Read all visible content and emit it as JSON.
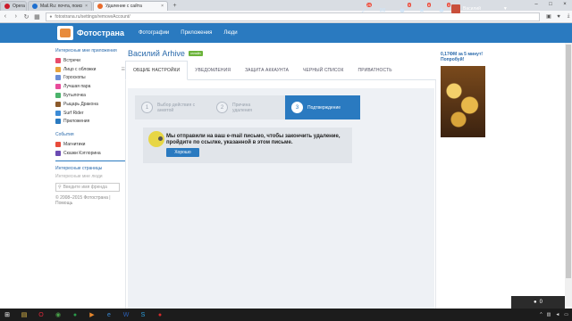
{
  "browser": {
    "tabs": [
      {
        "label": "Opera",
        "color": "#cc1b2b",
        "active": false
      },
      {
        "label": "Mail.Ru: почта, поиск в ...",
        "color": "#1e6fcf",
        "active": false
      },
      {
        "label": "Удаление с сайта",
        "color": "#e86b2c",
        "active": true
      }
    ],
    "url": "fotostrana.ru/settings/removeAccount/"
  },
  "site": {
    "logo": "Фотострана",
    "nav": [
      "Фотографии",
      "Приложения",
      "Люди"
    ],
    "badges": [
      "25",
      "",
      "9",
      "8",
      "3"
    ],
    "user": "Василий"
  },
  "sidebar": {
    "apps_header": "Интересные мне приложения",
    "apps": [
      {
        "label": "Встречи",
        "color": "#e84b6b",
        "right": ""
      },
      {
        "label": "Лицо с обложки",
        "color": "#e8a23b",
        "right": "☰"
      },
      {
        "label": "Гороскопы",
        "color": "#6b8ed6",
        "right": ""
      },
      {
        "label": "Лучшая пара",
        "color": "#e84b9b",
        "right": ""
      },
      {
        "label": "Бутылочка",
        "color": "#4bb36b",
        "right": ""
      },
      {
        "label": "Рыцарь Дракона",
        "color": "#8b5a2b",
        "right": ""
      },
      {
        "label": "Surf Rider",
        "color": "#3b8bd6",
        "right": ""
      },
      {
        "label": "Приложения",
        "color": "#2a7ac0",
        "right": ""
      }
    ],
    "events_header": "События",
    "events": [
      {
        "label": "Магнитики",
        "color": "#e84b3b"
      },
      {
        "label": "Сказки Кэтлорина",
        "color": "#6b4bb3"
      }
    ],
    "pages_header": "Интересные страницы",
    "pages_muted": "Интересные мне люди",
    "search_placeholder": "Введите имя френда",
    "copyright": "© 2008–2015 Фотострана | Помощь"
  },
  "main": {
    "title": "Василий Arhive",
    "status": "онлайн",
    "tabs": [
      "ОБЩИЕ НАСТРОЙКИ",
      "УВЕДОМЛЕНИЯ",
      "ЗАЩИТА АККАУНТА",
      "ЧЕРНЫЙ СПИСОК",
      "ПРИВАТНОСТЬ"
    ],
    "steps": [
      {
        "num": "1",
        "label": "Выбор действия с анкетой"
      },
      {
        "num": "2",
        "label": "Причина удаления"
      },
      {
        "num": "3",
        "label": "Подтверждение"
      }
    ],
    "message": "Мы отправили на ваш e-mail письмо, чтобы закончить удаление, пройдите по ссылке, указанной в этом письме.",
    "ok_button": "Хорошо"
  },
  "ad": {
    "title": "0,17ФМ за 5 минут! Попробуй!"
  },
  "chat": {
    "count": "0"
  },
  "taskbar": {
    "icons": [
      {
        "name": "windows-start-icon",
        "glyph": "⊞",
        "color": "#ffffff"
      },
      {
        "name": "explorer-icon",
        "glyph": "▤",
        "color": "#e8c24a"
      },
      {
        "name": "opera-icon",
        "glyph": "O",
        "color": "#e0283b"
      },
      {
        "name": "chrome-icon",
        "glyph": "◉",
        "color": "#4aa34a"
      },
      {
        "name": "camtasia-icon",
        "glyph": "●",
        "color": "#2a9a4a"
      },
      {
        "name": "media-icon",
        "glyph": "▶",
        "color": "#e8872c"
      },
      {
        "name": "ie-icon",
        "glyph": "e",
        "color": "#3b8bd6"
      },
      {
        "name": "word-icon",
        "glyph": "W",
        "color": "#2b5fb3"
      },
      {
        "name": "skype-icon",
        "glyph": "S",
        "color": "#2ba0e0"
      },
      {
        "name": "recorder-icon",
        "glyph": "●",
        "color": "#d62b2b"
      }
    ]
  }
}
